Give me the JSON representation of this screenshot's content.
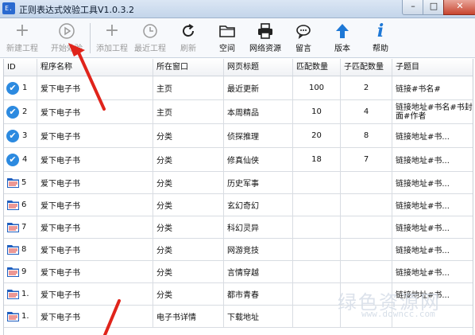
{
  "window": {
    "title": "正则表达式效验工具V1.0.3.2",
    "app_icon_text": "E.",
    "minimize_label": "–",
    "maximize_label": "□",
    "close_label": "✕"
  },
  "toolbar": {
    "buttons": [
      {
        "label": "新建工程",
        "icon": "plus-icon",
        "glyph": "+",
        "enabled": false
      },
      {
        "label": "开始效验",
        "icon": "play-icon",
        "glyph": "⏵",
        "enabled": false
      },
      {
        "label": "添加工程",
        "icon": "plus-icon",
        "glyph": "+",
        "enabled": false
      },
      {
        "label": "最近工程",
        "icon": "clock-icon",
        "glyph": "◷",
        "enabled": false
      },
      {
        "label": "刷新",
        "icon": "refresh-icon",
        "glyph": "↻",
        "enabled": false
      },
      {
        "label": "空间",
        "icon": "folder-icon",
        "glyph": "",
        "enabled": true
      },
      {
        "label": "网络资源",
        "icon": "printer-icon",
        "glyph": "",
        "enabled": true
      },
      {
        "label": "留言",
        "icon": "speech-bubble-icon",
        "glyph": "",
        "enabled": true
      },
      {
        "label": "版本",
        "icon": "up-arrow-icon",
        "glyph": "⬆",
        "enabled": true
      },
      {
        "label": "帮助",
        "icon": "info-icon",
        "glyph": "i",
        "enabled": true
      }
    ]
  },
  "table": {
    "columns": [
      "ID",
      "程序名称",
      "所在窗口",
      "网页标题",
      "匹配数量",
      "子匹配数量",
      "子题目"
    ],
    "rows": [
      {
        "status": "check",
        "id": "1",
        "name": "爱下电子书",
        "window": "主页",
        "title": "最近更新",
        "count": "100",
        "sub": "2",
        "sub_title": "链接#书名#"
      },
      {
        "status": "check",
        "id": "2",
        "name": "爱下电子书",
        "window": "主页",
        "title": "本周精品",
        "count": "10",
        "sub": "4",
        "sub_title": "链接地址#书名#书封面#作者"
      },
      {
        "status": "check",
        "id": "3",
        "name": "爱下电子书",
        "window": "分类",
        "title": "侦探推理",
        "count": "20",
        "sub": "8",
        "sub_title": "链接地址#书..."
      },
      {
        "status": "check",
        "id": "4",
        "name": "爱下电子书",
        "window": "分类",
        "title": "修真仙侠",
        "count": "18",
        "sub": "7",
        "sub_title": "链接地址#书..."
      },
      {
        "status": "folder",
        "id": "5",
        "name": "爱下电子书",
        "window": "分类",
        "title": "历史军事",
        "count": "",
        "sub": "",
        "sub_title": "链接地址#书..."
      },
      {
        "status": "folder",
        "id": "6",
        "name": "爱下电子书",
        "window": "分类",
        "title": "玄幻奇幻",
        "count": "",
        "sub": "",
        "sub_title": "链接地址#书..."
      },
      {
        "status": "folder",
        "id": "7",
        "name": "爱下电子书",
        "window": "分类",
        "title": "科幻灵异",
        "count": "",
        "sub": "",
        "sub_title": "链接地址#书..."
      },
      {
        "status": "folder",
        "id": "8",
        "name": "爱下电子书",
        "window": "分类",
        "title": "网游竞技",
        "count": "",
        "sub": "",
        "sub_title": "链接地址#书..."
      },
      {
        "status": "folder",
        "id": "9",
        "name": "爱下电子书",
        "window": "分类",
        "title": "言情穿越",
        "count": "",
        "sub": "",
        "sub_title": "链接地址#书..."
      },
      {
        "status": "folder",
        "id": "1.",
        "name": "爱下电子书",
        "window": "分类",
        "title": "都市青春",
        "count": "",
        "sub": "",
        "sub_title": "链接地址#书..."
      },
      {
        "status": "folder",
        "id": "1.",
        "name": "爱下电子书",
        "window": "电子书详情",
        "title": "下载地址",
        "count": "",
        "sub": "",
        "sub_title": ""
      }
    ]
  },
  "colors": {
    "check": "#2c8ae0",
    "folder_blue": "#1f5fbf",
    "folder_red": "#d8322b",
    "arrow_red": "#e0241b"
  },
  "watermark": {
    "text": "绿色资源网",
    "url": "www.downcc.com"
  }
}
